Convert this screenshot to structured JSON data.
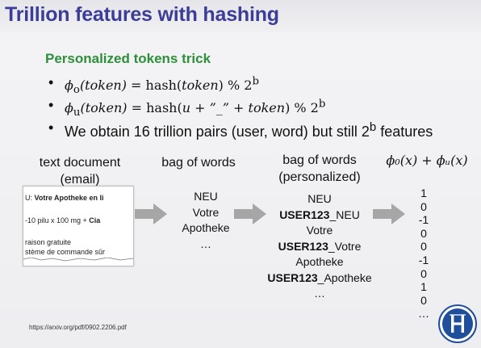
{
  "slide": {
    "title": "Trillion features with hashing",
    "subtitle": "Personalized tokens trick"
  },
  "bullets": {
    "b1": {
      "lhs_fn": "ϕ",
      "lhs_sub": "o",
      "lhs_arg": "(token)",
      "eq": " = hash(",
      "arg": "token",
      "close": ") % 2",
      "sup": "b"
    },
    "b2": {
      "lhs_fn": "ϕ",
      "lhs_sub": "u",
      "lhs_arg": "(token)",
      "eq": " = hash(",
      "arg": "u + ”_” + token",
      "close": ") % 2",
      "sup": "b"
    },
    "b3": {
      "text": "We obtain 16 trillion pairs (user, word) but still 2",
      "sup": "b",
      "tail": " features"
    }
  },
  "columns": {
    "text_document": "text document",
    "email": "(email)",
    "bag_of_words": "bag of words",
    "bag_personalized": "bag of words",
    "personalized": "(personalized)",
    "formula": "ϕ₀(x) + ϕᵤ(x)"
  },
  "document_snippet": {
    "line1_prefix": "U: ",
    "line1_bold": "Votre Apotheke en li",
    "line2_prefix": "-10 pilu x 100 mg + ",
    "line2_bold": "Cia",
    "line3": "raison gratuite",
    "line4": "stème de commande sûr"
  },
  "bag_of_words": [
    "NEU",
    "Votre",
    "Apotheke",
    "…"
  ],
  "bag_personalized": [
    {
      "bold": "",
      "text": "NEU"
    },
    {
      "bold": "USER123",
      "text": "_NEU"
    },
    {
      "bold": "",
      "text": "Votre"
    },
    {
      "bold": "USER123",
      "text": "_Votre"
    },
    {
      "bold": "",
      "text": "Apotheke"
    },
    {
      "bold": "USER123",
      "text": "_Apotheke"
    },
    {
      "bold": "",
      "text": "…"
    }
  ],
  "feature_vector": [
    "1",
    "0",
    "-1",
    "0",
    "0",
    "-1",
    "0",
    "1",
    "0",
    "…"
  ],
  "footer": {
    "url": "https://arxiv.org/pdf/0902.2206.pdf"
  },
  "colors": {
    "title": "#3b3d96",
    "subtitle": "#2e8f3b",
    "arrow": "#a6a6a6",
    "logo": "#1f4e9b"
  },
  "icons": {
    "arrow": "right-arrow-icon",
    "logo": "university-logo-icon"
  }
}
